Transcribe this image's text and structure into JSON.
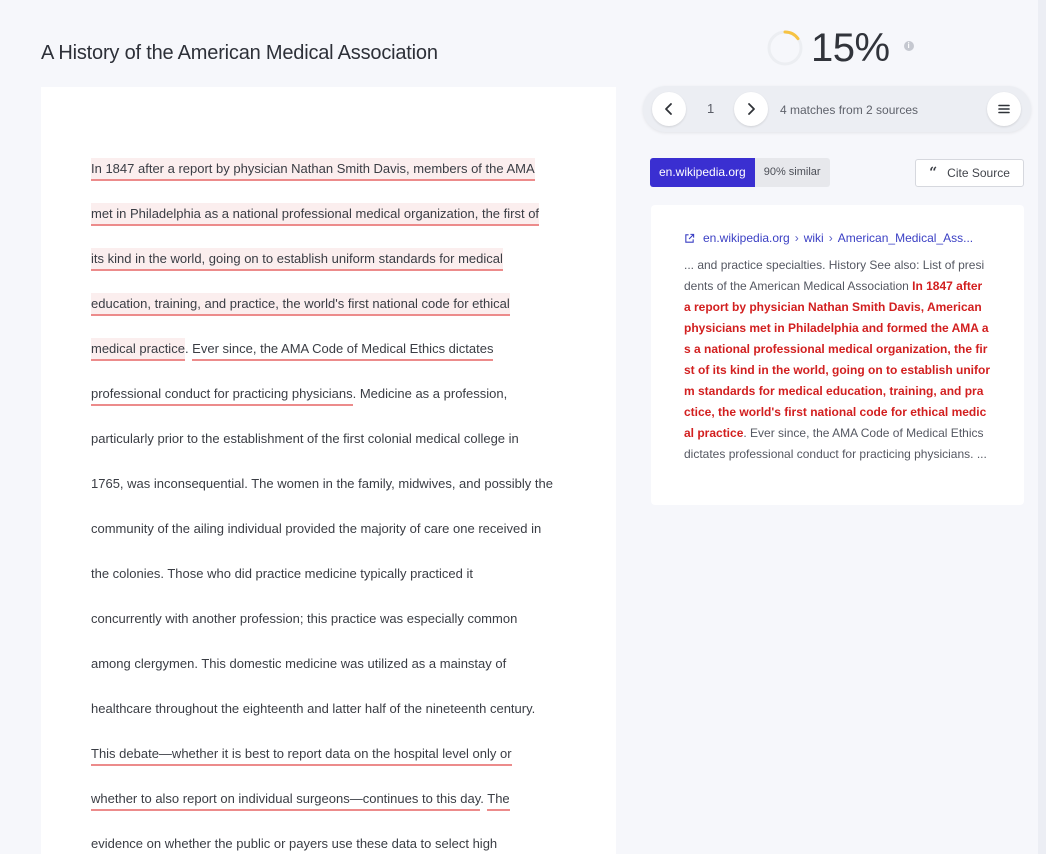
{
  "document": {
    "title": "A History of the American Medical Association",
    "lines": [
      [
        {
          "t": "In 1847 after a report by physician Nathan Smith Davis, members of the AMA",
          "h": "bg"
        }
      ],
      [
        {
          "t": "met in Philadelphia as a national professional medical organization, the first of",
          "h": "bg"
        }
      ],
      [
        {
          "t": "its kind in the world, going on to establish uniform standards for medical",
          "h": "bg"
        }
      ],
      [
        {
          "t": "education, training, and practice, the world's first national code for ethical",
          "h": "bg"
        }
      ],
      [
        {
          "t": "medical practice",
          "h": "bg"
        },
        {
          "t": ". ",
          "h": ""
        },
        {
          "t": "Ever since, the AMA Code of Medical Ethics dictates",
          "h": "line"
        }
      ],
      [
        {
          "t": "professional conduct for practicing physicians",
          "h": "line"
        },
        {
          "t": ". Medicine as a profession,",
          "h": ""
        }
      ],
      [
        {
          "t": "particularly prior to the establishment of the first colonial medical college in",
          "h": ""
        }
      ],
      [
        {
          "t": "1765, was inconsequential. The women in the family, midwives, and possibly the",
          "h": ""
        }
      ],
      [
        {
          "t": "community of the ailing individual provided the majority of care one received in",
          "h": ""
        }
      ],
      [
        {
          "t": "the colonies. Those who did practice medicine typically practiced it",
          "h": ""
        }
      ],
      [
        {
          "t": "concurrently with another profession; this practice was especially common",
          "h": ""
        }
      ],
      [
        {
          "t": "among clergymen. This domestic medicine was utilized as a mainstay of",
          "h": ""
        }
      ],
      [
        {
          "t": "healthcare throughout the eighteenth and latter half of the nineteenth century.",
          "h": ""
        }
      ],
      [
        {
          "t": "This debate—whether it is best to report data on the hospital level only or",
          "h": "line"
        }
      ],
      [
        {
          "t": "whether to also report on individual surgeons—continues to this day",
          "h": "line"
        },
        {
          "t": ". ",
          "h": ""
        },
        {
          "t": "The",
          "h": "line"
        }
      ],
      [
        {
          "t": "evidence on whether the public or payers use these data to select high",
          "h": "line"
        }
      ]
    ]
  },
  "score": {
    "value": "15%",
    "fraction": 0.15,
    "info_icon": "info-icon"
  },
  "match_nav": {
    "page": "1",
    "summary": "4 matches from 2 sources",
    "prev_icon": "chevron-left-icon",
    "next_icon": "chevron-right-icon",
    "menu_icon": "hamburger-menu-icon"
  },
  "source": {
    "domain": "en.wikipedia.org",
    "similarity": "90% similar",
    "cite_label": "Cite Source",
    "cite_icon": "quote-icon"
  },
  "source_card": {
    "breadcrumb": [
      "en.wikipedia.org",
      "wiki",
      "American_Medical_Ass..."
    ],
    "breadcrumb_sep": "›",
    "snippet_before": "... and practice specialties. History See also: List of presidents of the American Medical Association ",
    "snippet_match": "In 1847 after a report by physician Nathan Smith Davis, American physicians met in Philadelphia and formed the AMA as a national professional medical organization, the first of its kind in the world, going on to establish uniform standards for medical education, training, and practice, the world's first national code for ethical medical practice",
    "snippet_after": ". Ever since, the AMA Code of Medical Ethics dictates professional conduct for practicing physicians. ..."
  },
  "colors": {
    "accent": "#3a2fd1",
    "highlight_underline": "#ec8b8b",
    "highlight_bg": "#fbeeee",
    "match_text": "#d21f1f",
    "score_ring": "#f6c343"
  }
}
